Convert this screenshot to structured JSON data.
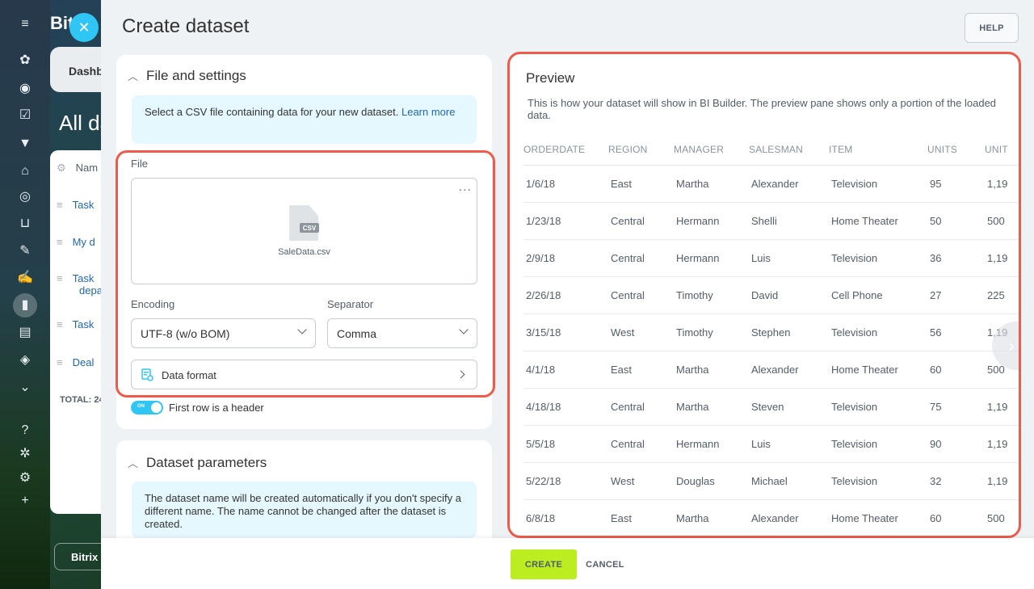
{
  "background": {
    "brand": "Bit",
    "tab_label": "Dashb",
    "title": "All da",
    "list_header": "Nam",
    "rows": [
      {
        "label": "Task",
        "label2": ""
      },
      {
        "label": "My d",
        "label2": ""
      },
      {
        "label": "Task",
        "label2": "depa"
      },
      {
        "label": "Task",
        "label2": ""
      },
      {
        "label": "Deal",
        "label2": ""
      }
    ],
    "total": "TOTAL: 24",
    "bottom_button": "Bitrix"
  },
  "slider": {
    "title": "Create dataset",
    "help_label": "HELP"
  },
  "file_settings": {
    "heading": "File and settings",
    "info_text": "Select a CSV file containing data for your new dataset.",
    "info_link": "Learn more",
    "file_label": "File",
    "file_name": "SaleData.csv",
    "file_badge": "CSV",
    "more_icon": "...",
    "encoding_label": "Encoding",
    "encoding_value": "UTF-8 (w/o BOM)",
    "separator_label": "Separator",
    "separator_value": "Comma",
    "data_format_label": "Data format",
    "toggle_state": "ON",
    "toggle_label": "First row is a header"
  },
  "dataset_params": {
    "heading": "Dataset parameters",
    "info_text": "The dataset name will be created automatically if you don't specify a different name. The name cannot be changed after the dataset is created."
  },
  "preview": {
    "title": "Preview",
    "description": "This is how your dataset will show in BI Builder. The preview pane shows only a portion of the loaded data.",
    "columns": [
      "ORDERDATE",
      "REGION",
      "MANAGER",
      "SALESMAN",
      "ITEM",
      "UNITS",
      "UNIT"
    ],
    "rows": [
      [
        "1/6/18",
        "East",
        "Martha",
        "Alexander",
        "Television",
        "95",
        "1,19"
      ],
      [
        "1/23/18",
        "Central",
        "Hermann",
        "Shelli",
        "Home Theater",
        "50",
        "500"
      ],
      [
        "2/9/18",
        "Central",
        "Hermann",
        "Luis",
        "Television",
        "36",
        "1,19"
      ],
      [
        "2/26/18",
        "Central",
        "Timothy",
        "David",
        "Cell Phone",
        "27",
        "225"
      ],
      [
        "3/15/18",
        "West",
        "Timothy",
        "Stephen",
        "Television",
        "56",
        "1,19"
      ],
      [
        "4/1/18",
        "East",
        "Martha",
        "Alexander",
        "Home Theater",
        "60",
        "500"
      ],
      [
        "4/18/18",
        "Central",
        "Martha",
        "Steven",
        "Television",
        "75",
        "1,19"
      ],
      [
        "5/5/18",
        "Central",
        "Hermann",
        "Luis",
        "Television",
        "90",
        "1,19"
      ],
      [
        "5/22/18",
        "West",
        "Douglas",
        "Michael",
        "Television",
        "32",
        "1,19"
      ],
      [
        "6/8/18",
        "East",
        "Martha",
        "Alexander",
        "Home Theater",
        "60",
        "500"
      ]
    ]
  },
  "footer": {
    "create_label": "CREATE",
    "cancel_label": "CANCEL"
  },
  "icons": {
    "menu": "menu-icon",
    "close": "close-icon",
    "next": "chevron-right-icon",
    "csv": "csv-file-icon",
    "more": "more-dots-icon",
    "format": "data-format-icon"
  },
  "colors": {
    "accent": "#2fc6f6",
    "create_button": "#bbed21",
    "highlight_frame": "#ef5b4b",
    "link": "#2066b0"
  }
}
